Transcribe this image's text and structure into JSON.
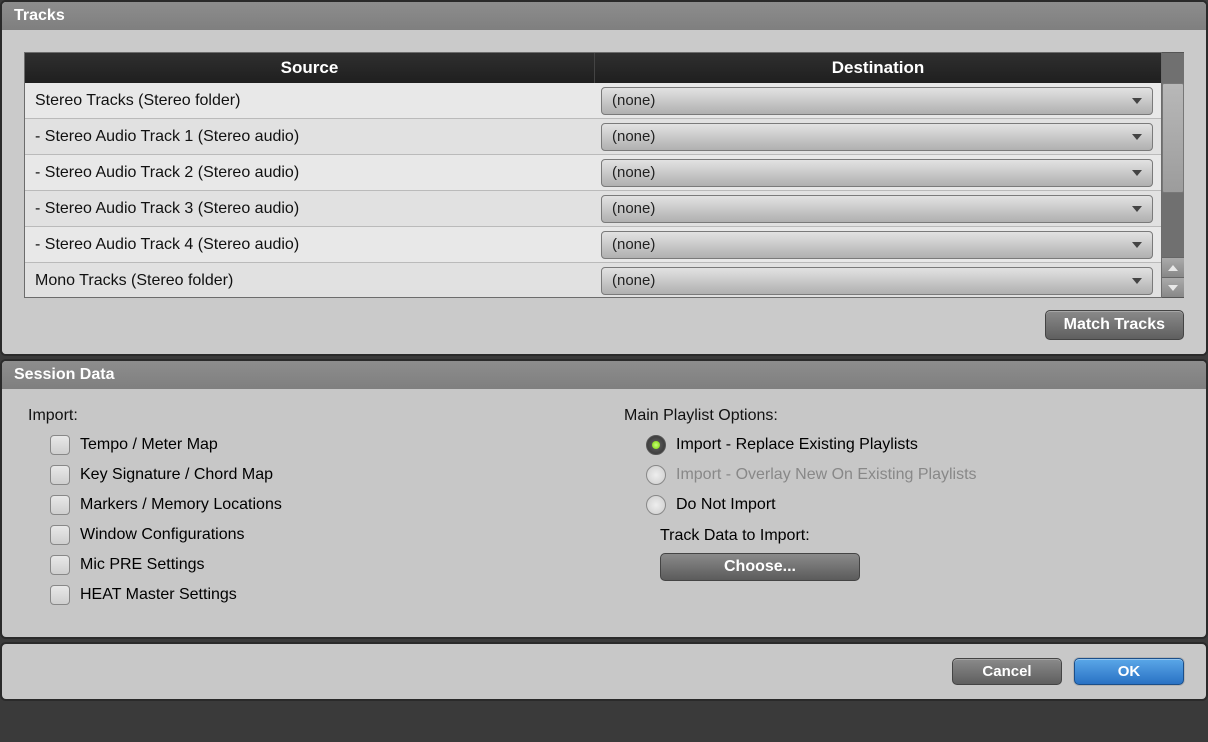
{
  "tracks_panel": {
    "title": "Tracks",
    "headers": {
      "source": "Source",
      "destination": "Destination"
    },
    "rows": [
      {
        "source": "Stereo Tracks (Stereo folder)",
        "destination": "(none)"
      },
      {
        "source": "- Stereo Audio Track 1 (Stereo audio)",
        "destination": "(none)"
      },
      {
        "source": "- Stereo Audio Track 2 (Stereo audio)",
        "destination": "(none)"
      },
      {
        "source": "- Stereo Audio Track 3 (Stereo audio)",
        "destination": "(none)"
      },
      {
        "source": "- Stereo Audio Track 4 (Stereo audio)",
        "destination": "(none)"
      },
      {
        "source": "Mono Tracks (Stereo folder)",
        "destination": "(none)"
      }
    ],
    "match_button": "Match Tracks"
  },
  "session_panel": {
    "title": "Session Data",
    "import_label": "Import:",
    "import_options": [
      "Tempo / Meter Map",
      "Key Signature / Chord Map",
      "Markers / Memory Locations",
      "Window Configurations",
      "Mic PRE Settings",
      "HEAT Master Settings"
    ],
    "playlist_label": "Main Playlist Options:",
    "playlist_options": [
      {
        "label": "Import - Replace Existing Playlists",
        "selected": true,
        "disabled": false
      },
      {
        "label": "Import - Overlay New On Existing Playlists",
        "selected": false,
        "disabled": true
      },
      {
        "label": "Do Not Import",
        "selected": false,
        "disabled": false
      }
    ],
    "track_data_label": "Track Data to Import:",
    "choose_button": "Choose..."
  },
  "footer": {
    "cancel": "Cancel",
    "ok": "OK"
  }
}
